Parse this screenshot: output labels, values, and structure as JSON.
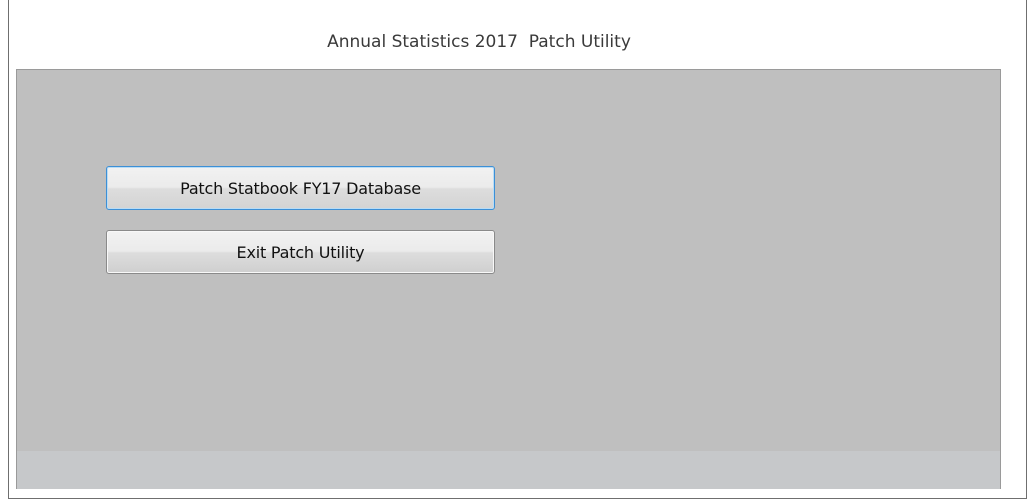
{
  "window": {
    "title": "Annual Statistics 2017  Patch Utility"
  },
  "buttons": {
    "patch_label": "Patch Statbook FY17 Database",
    "exit_label": "Exit Patch Utility"
  },
  "colors": {
    "panel_background": "#bfbfbf",
    "focus_border": "#3c8fd6",
    "window_background": "#ffffff"
  }
}
